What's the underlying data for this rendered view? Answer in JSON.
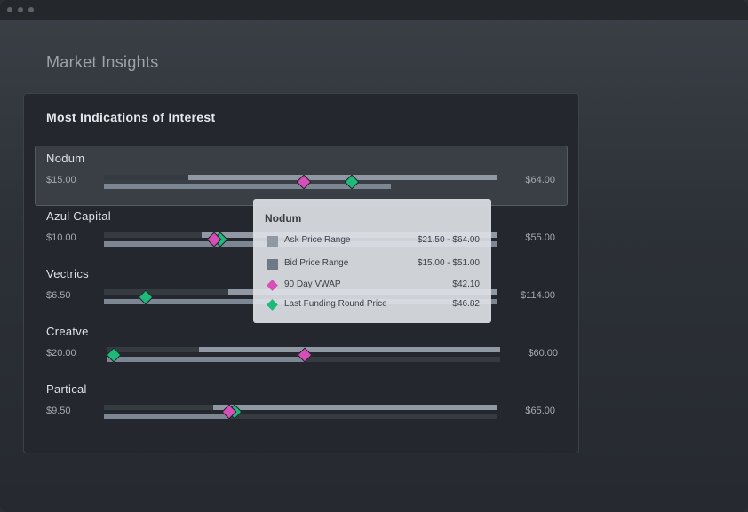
{
  "window": {
    "controls": [
      "close-dot",
      "minimize-dot",
      "zoom-dot"
    ]
  },
  "page": {
    "title": "Market Insights"
  },
  "card": {
    "title": "Most Indications of Interest",
    "rows": [
      {
        "name": "Nodum",
        "low": "$15.00",
        "high": "$64.00",
        "highlighted": true
      },
      {
        "name": "Azul Capital",
        "low": "$10.00",
        "high": "$55.00"
      },
      {
        "name": "Vectrics",
        "low": "$6.50",
        "high": "$114.00"
      },
      {
        "name": "Creatve",
        "low": "$20.00",
        "high": "$60.00"
      },
      {
        "name": "Partical",
        "low": "$9.50",
        "high": "$65.00"
      }
    ]
  },
  "tooltip": {
    "title": "Nodum",
    "items": [
      {
        "label": "Ask Price Range",
        "value": "$21.50 - $64.00",
        "icon": "square-swatch",
        "color": "#8f98a3"
      },
      {
        "label": "Bid Price Range",
        "value": "$15.00 - $51.00",
        "icon": "square-swatch",
        "color": "#6f7885"
      },
      {
        "label": "90 Day VWAP",
        "value": "$42.10",
        "icon": "diamond",
        "color": "#d64fb8"
      },
      {
        "label": "Last Funding Round Price",
        "value": "$46.82",
        "icon": "diamond",
        "color": "#1fb97a"
      }
    ]
  },
  "colors": {
    "ask_range": "#8f98a3",
    "bid_range": "#7d8794",
    "vwap": "#d64fb8",
    "last_funding": "#1fb97a"
  }
}
